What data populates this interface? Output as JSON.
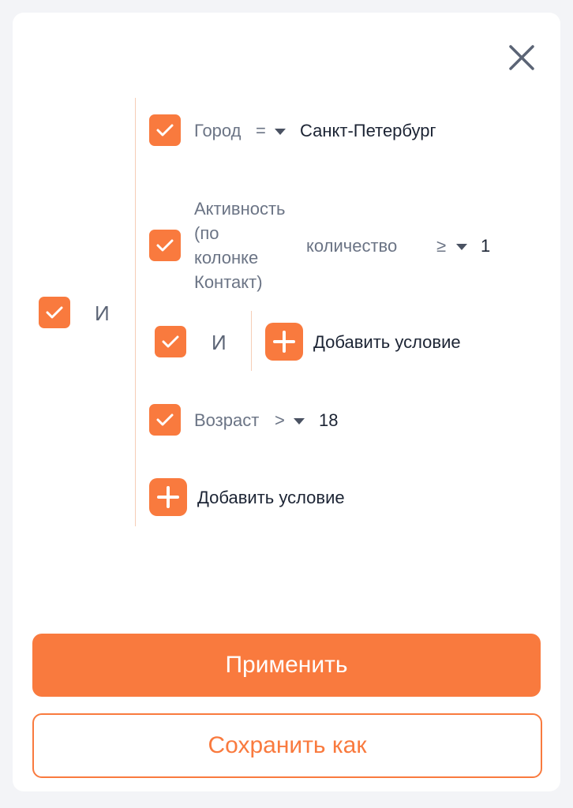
{
  "colors": {
    "accent": "#f97a3e",
    "label": "#6b7485",
    "value": "#1c2434",
    "divider": "#f6cdb6"
  },
  "filter": {
    "root_logic": "И",
    "conditions": [
      {
        "field": "Город",
        "operator": "=",
        "value": "Санкт-Петербург"
      },
      {
        "field_lines": [
          "Активность",
          "(по",
          "колонке",
          "Контакт)"
        ],
        "aggregate": "количество",
        "operator": "≥",
        "value": "1"
      },
      {
        "field": "Возраст",
        "operator": ">",
        "value": "18"
      }
    ],
    "subgroup": {
      "logic": "И",
      "add_label": "Добавить условие"
    },
    "add_label": "Добавить условие"
  },
  "actions": {
    "apply_label": "Применить",
    "save_as_label": "Сохранить как"
  },
  "icons": {
    "close": "close-icon",
    "check": "check-icon",
    "plus": "plus-icon",
    "caret": "caret-down-icon"
  }
}
